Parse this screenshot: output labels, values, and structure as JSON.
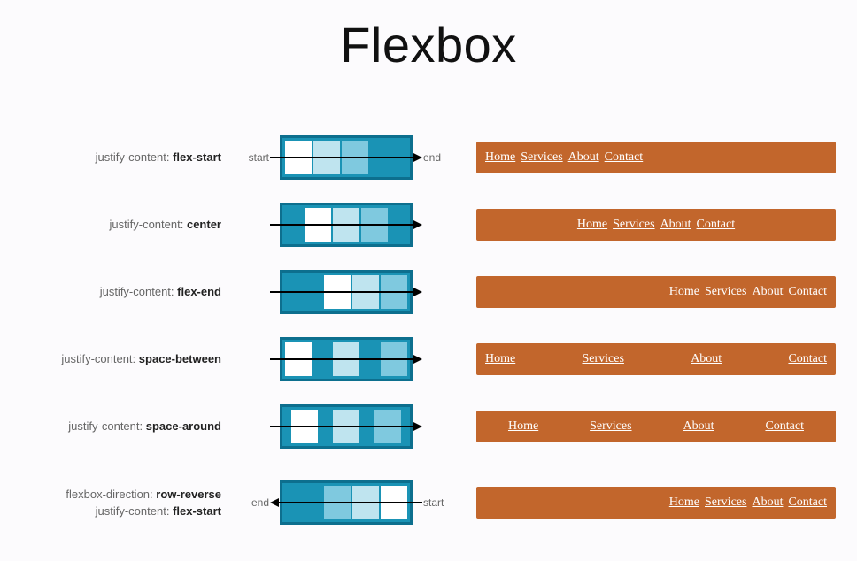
{
  "title": "Flexbox",
  "nav_links": [
    "Home",
    "Services",
    "About",
    "Contact"
  ],
  "axis_labels": {
    "start": "start",
    "end": "end"
  },
  "rows": [
    {
      "label_lines": [
        {
          "prop": "justify-content:",
          "val": "flex-start"
        }
      ],
      "left_axis": "start",
      "right_axis": "end",
      "diagram_class": "jc-flex-start",
      "arrow": "fwd",
      "nav_class": "jc-flex-start"
    },
    {
      "label_lines": [
        {
          "prop": "justify-content:",
          "val": "center"
        }
      ],
      "left_axis": "",
      "right_axis": "",
      "diagram_class": "jc-center",
      "arrow": "fwd",
      "nav_class": "jc-center"
    },
    {
      "label_lines": [
        {
          "prop": "justify-content:",
          "val": "flex-end"
        }
      ],
      "left_axis": "",
      "right_axis": "",
      "diagram_class": "jc-flex-end",
      "arrow": "fwd",
      "nav_class": "jc-flex-end"
    },
    {
      "label_lines": [
        {
          "prop": "justify-content:",
          "val": "space-between"
        }
      ],
      "left_axis": "",
      "right_axis": "",
      "diagram_class": "jc-space-between",
      "arrow": "fwd",
      "nav_class": "jc-space-between"
    },
    {
      "label_lines": [
        {
          "prop": "justify-content:",
          "val": "space-around"
        }
      ],
      "left_axis": "",
      "right_axis": "",
      "diagram_class": "jc-space-around",
      "arrow": "fwd",
      "nav_class": "jc-space-around"
    },
    {
      "label_lines": [
        {
          "prop": "flexbox-direction:",
          "val": "row-reverse"
        },
        {
          "prop": "justify-content:",
          "val": "flex-start"
        }
      ],
      "left_axis": "end",
      "right_axis": "start",
      "diagram_class": "jc-flex-start row-reverse",
      "arrow": "rev",
      "nav_class": "row-reverse-vis"
    }
  ]
}
